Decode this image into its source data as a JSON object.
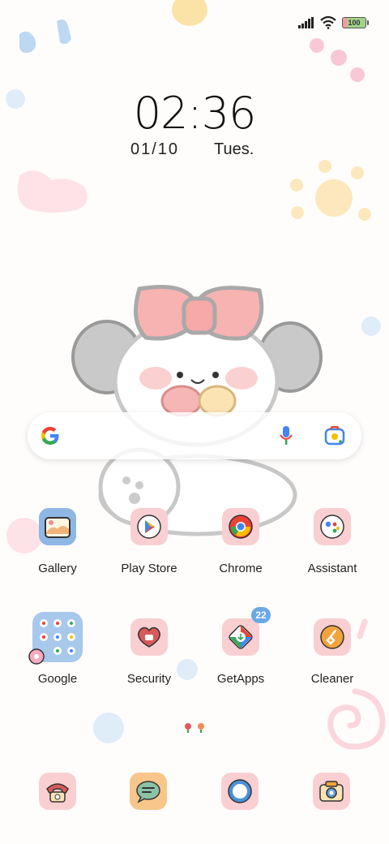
{
  "status": {
    "battery": "100"
  },
  "lockscreen": {
    "time": "02:36",
    "date": "01/10",
    "day": "Tues."
  },
  "apps_row1": [
    {
      "label": "Gallery"
    },
    {
      "label": "Play Store"
    },
    {
      "label": "Chrome"
    },
    {
      "label": "Assistant"
    }
  ],
  "apps_row2": [
    {
      "label": "Google"
    },
    {
      "label": "Security"
    },
    {
      "label": "GetApps",
      "badge": "22"
    },
    {
      "label": "Cleaner"
    }
  ],
  "colors": {
    "tile_pink": "#f9cfd2",
    "bow": "#f6a9a7",
    "badge": "#6ba8e6"
  }
}
